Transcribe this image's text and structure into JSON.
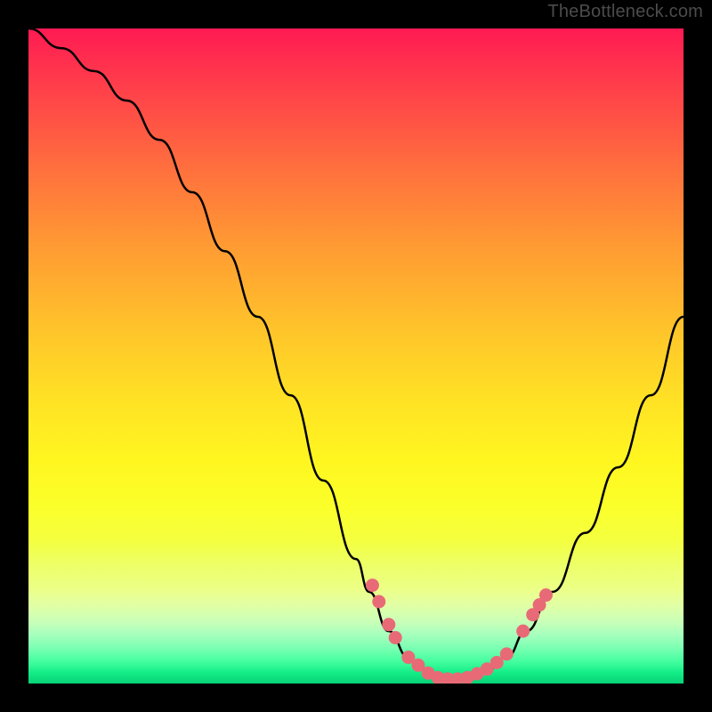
{
  "watermark": "TheBottleneck.com",
  "colors": {
    "page_bg": "#000000",
    "curve_stroke": "#000000",
    "dot_fill": "#e86a77",
    "gradient_top": "#ff1a53",
    "gradient_mid": "#fff620",
    "gradient_bottom": "#08d176"
  },
  "chart_data": {
    "type": "line",
    "title": "",
    "xlabel": "",
    "ylabel": "",
    "xlim": [
      0,
      100
    ],
    "ylim": [
      0,
      100
    ],
    "grid": false,
    "legend": false,
    "series": [
      {
        "name": "bottleneck-curve",
        "x": [
          0,
          5,
          10,
          15,
          20,
          25,
          30,
          35,
          40,
          45,
          50,
          52,
          55,
          58,
          60,
          62,
          64,
          66,
          68,
          70,
          73,
          76,
          80,
          85,
          90,
          95,
          100
        ],
        "y": [
          100,
          97,
          93.5,
          89,
          83,
          75,
          66,
          56,
          44,
          31,
          19,
          14,
          8,
          4,
          2.3,
          1.2,
          0.7,
          0.7,
          1.2,
          2,
          4,
          8,
          14,
          23,
          33,
          44,
          56
        ]
      }
    ],
    "highlight_dots": {
      "name": "curve-dots",
      "points": [
        {
          "x": 52.5,
          "y": 15
        },
        {
          "x": 53.5,
          "y": 12.5
        },
        {
          "x": 55.0,
          "y": 9
        },
        {
          "x": 56.0,
          "y": 7
        },
        {
          "x": 58.0,
          "y": 4
        },
        {
          "x": 59.5,
          "y": 2.8
        },
        {
          "x": 61.0,
          "y": 1.6
        },
        {
          "x": 62.5,
          "y": 0.9
        },
        {
          "x": 64.0,
          "y": 0.7
        },
        {
          "x": 65.5,
          "y": 0.7
        },
        {
          "x": 67.0,
          "y": 0.9
        },
        {
          "x": 68.5,
          "y": 1.5
        },
        {
          "x": 70.0,
          "y": 2.2
        },
        {
          "x": 71.5,
          "y": 3.2
        },
        {
          "x": 73.0,
          "y": 4.5
        },
        {
          "x": 75.5,
          "y": 8
        },
        {
          "x": 77.0,
          "y": 10.5
        },
        {
          "x": 78.0,
          "y": 12
        },
        {
          "x": 79.0,
          "y": 13.5
        }
      ]
    }
  }
}
